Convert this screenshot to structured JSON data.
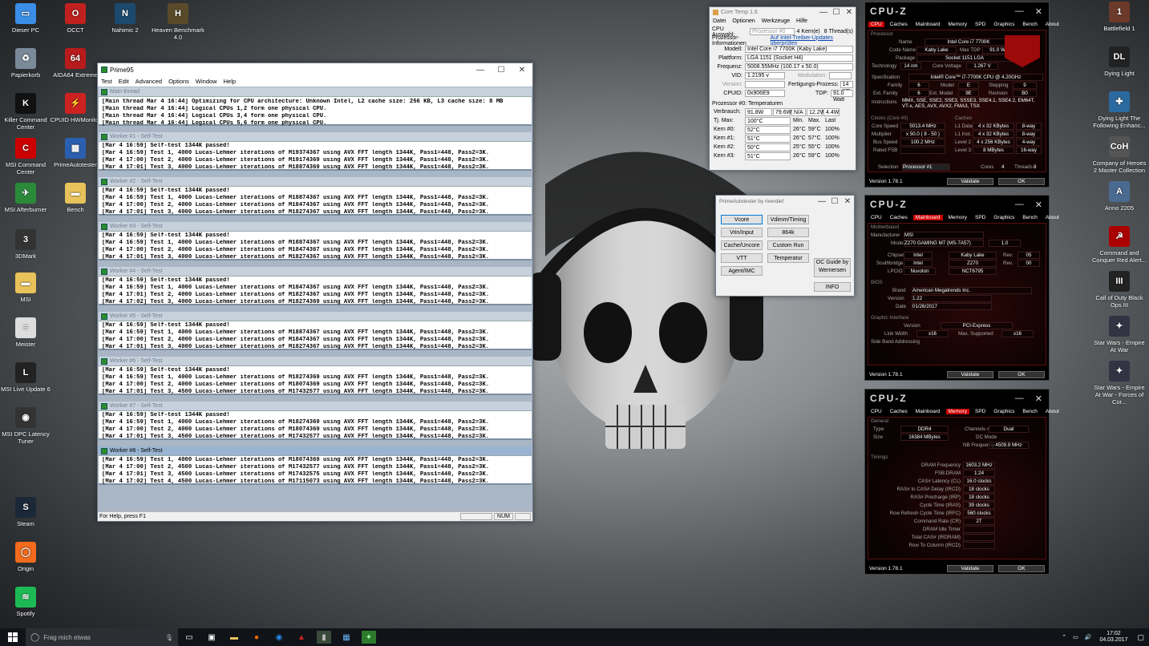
{
  "colors": {
    "accent": "#c00000",
    "p95_title": "#99b4d1",
    "taskbar": "#101418"
  },
  "desktop_left": [
    {
      "label": "Dieser PC",
      "icon": "computer-icon",
      "color": "#3a8ee6",
      "glyph": "▭"
    },
    {
      "label": "OCCT",
      "icon": "occt-icon",
      "color": "#c0211f",
      "glyph": "O"
    },
    {
      "label": "Nahimic 2",
      "icon": "nahimic-icon",
      "color": "#1c4a6e",
      "glyph": "N"
    },
    {
      "label": "Heaven Benchmark 4.0",
      "icon": "heaven-icon",
      "color": "#5a4a2a",
      "glyph": "H"
    },
    {
      "label": "Papierkorb",
      "icon": "recycle-bin-icon",
      "color": "#7a8a99",
      "glyph": "♻"
    },
    {
      "label": "AIDA64 Extreme",
      "icon": "aida64-icon",
      "color": "#b81b1b",
      "glyph": "64"
    },
    {
      "label": "Killer Command Center",
      "icon": "killer-icon",
      "color": "#111",
      "glyph": "K"
    },
    {
      "label": "CPUID HWMonitor",
      "icon": "hwmonitor-icon",
      "color": "#c22",
      "glyph": "⚡"
    },
    {
      "label": "MSI Command Center",
      "icon": "msi-cc-icon",
      "color": "#c00",
      "glyph": "C"
    },
    {
      "label": "PrimeAutotester",
      "icon": "primeautotester-icon",
      "color": "#2b5fb0",
      "glyph": "▦"
    },
    {
      "label": "MSI Afterburner",
      "icon": "afterburner-icon",
      "color": "#2a8a3a",
      "glyph": "✈"
    },
    {
      "label": "Bench",
      "icon": "folder-icon",
      "color": "#e8c25a",
      "glyph": "▬"
    },
    {
      "label": "3DMark",
      "icon": "3dmark-icon",
      "color": "#333",
      "glyph": "3"
    },
    {
      "label": "MSI",
      "icon": "folder-icon",
      "color": "#e8c25a",
      "glyph": "▬"
    },
    {
      "label": "Meister",
      "icon": "document-icon",
      "color": "#ddd",
      "glyph": "≡"
    },
    {
      "label": "MSI Live Update 6",
      "icon": "live-update-icon",
      "color": "#222",
      "glyph": "L"
    },
    {
      "label": "MSI DPC Latency Tuner",
      "icon": "dpc-icon",
      "color": "#333",
      "glyph": "◉"
    },
    {
      "label": "Steam",
      "icon": "steam-icon",
      "color": "#1b2838",
      "glyph": "S"
    },
    {
      "label": "Origin",
      "icon": "origin-icon",
      "color": "#f36c1e",
      "glyph": "◯"
    },
    {
      "label": "Spotify",
      "icon": "spotify-icon",
      "color": "#1db954",
      "glyph": "≋"
    }
  ],
  "desktop_right": [
    {
      "label": "Battlefield 1",
      "icon": "battlefield-icon",
      "color": "#6b3a2a",
      "glyph": "1"
    },
    {
      "label": "Dying Light",
      "icon": "dying-light-icon",
      "color": "#222",
      "glyph": "DL"
    },
    {
      "label": "Dying Light The Following Enhanc...",
      "icon": "dying-light-following-icon",
      "color": "#2a6aa0",
      "glyph": "✚"
    },
    {
      "label": "Company of Heroes 2 Master Collection",
      "icon": "coh2-icon",
      "color": "#555",
      "glyph": "CoH"
    },
    {
      "label": "Anno 2205",
      "icon": "anno-icon",
      "color": "#4a6a90",
      "glyph": "A"
    },
    {
      "label": "Command and Conquer Red Alert...",
      "icon": "red-alert-icon",
      "color": "#a00",
      "glyph": "☭"
    },
    {
      "label": "Call of Duty Black Ops III",
      "icon": "cod-icon",
      "color": "#222",
      "glyph": "III"
    },
    {
      "label": "Star Wars - Empire At War",
      "icon": "swe-icon",
      "color": "#334",
      "glyph": "✦"
    },
    {
      "label": "Star Wars - Empire At War - Forces of Cor...",
      "icon": "swe-foc-icon",
      "color": "#334",
      "glyph": "✦"
    }
  ],
  "prime95": {
    "title": "Prime95",
    "menu": [
      "Test",
      "Edit",
      "Advanced",
      "Options",
      "Window",
      "Help"
    ],
    "main_title": "Main thread",
    "main_lines": [
      "[Main thread Mar 4 16:44] Optimizing for CPU architecture: Unknown Intel, L2 cache size: 256 KB, L3 cache size: 8 MB",
      "[Main thread Mar 4 16:44] Logical CPUs 1,2 form one physical CPU.",
      "[Main thread Mar 4 16:44] Logical CPUs 3,4 form one physical CPU.",
      "[Main thread Mar 4 16:44] Logical CPUs 5,6 form one physical CPU."
    ],
    "workers": [
      {
        "title": "Worker #1 - Self-Test",
        "lines": [
          "[Mar 4 16:59] Self-test 1344K passed!",
          "[Mar 4 16:59] Test 1, 4000 Lucas-Lehmer iterations of M19374367 using AVX FFT length 1344K, Pass1=448, Pass2=3K.",
          "[Mar 4 17:00] Test 2, 4000 Lucas-Lehmer iterations of M19174369 using AVX FFT length 1344K, Pass1=448, Pass2=3K.",
          "[Mar 4 17:01] Test 3, 4000 Lucas-Lehmer iterations of M18874369 using AVX FFT length 1344K, Pass1=448, Pass2=3K."
        ]
      },
      {
        "title": "Worker #2 - Self-Test",
        "lines": [
          "[Mar 4 16:59] Self-test 1344K passed!",
          "[Mar 4 16:59] Test 1, 4000 Lucas-Lehmer iterations of M18874367 using AVX FFT length 1344K, Pass1=448, Pass2=3K.",
          "[Mar 4 17:00] Test 2, 4000 Lucas-Lehmer iterations of M18474367 using AVX FFT length 1344K, Pass1=448, Pass2=3K.",
          "[Mar 4 17:01] Test 3, 4000 Lucas-Lehmer iterations of M18274367 using AVX FFT length 1344K, Pass1=448, Pass2=3K."
        ]
      },
      {
        "title": "Worker #3 - Self-Test",
        "lines": [
          "[Mar 4 16:59] Self-test 1344K passed!",
          "[Mar 4 16:59] Test 1, 4000 Lucas-Lehmer iterations of M18874367 using AVX FFT length 1344K, Pass1=448, Pass2=3K.",
          "[Mar 4 17:00] Test 2, 4000 Lucas-Lehmer iterations of M18474367 using AVX FFT length 1344K, Pass1=448, Pass2=3K.",
          "[Mar 4 17:01] Test 3, 4000 Lucas-Lehmer iterations of M18274367 using AVX FFT length 1344K, Pass1=448, Pass2=3K."
        ]
      },
      {
        "title": "Worker #4 - Self-Test",
        "lines": [
          "[Mar 4 16:59] Self-test 1344K passed!",
          "[Mar 4 16:59] Test 1, 4000 Lucas-Lehmer iterations of M18474367 using AVX FFT length 1344K, Pass1=448, Pass2=3K.",
          "[Mar 4 17:01] Test 2, 4000 Lucas-Lehmer iterations of M18274367 using AVX FFT length 1344K, Pass1=448, Pass2=3K.",
          "[Mar 4 17:02] Test 3, 4000 Lucas-Lehmer iterations of M18274369 using AVX FFT length 1344K, Pass1=448, Pass2=3K."
        ]
      },
      {
        "title": "Worker #5 - Self-Test",
        "lines": [
          "[Mar 4 16:59] Self-test 1344K passed!",
          "[Mar 4 16:59] Test 1, 4000 Lucas-Lehmer iterations of M18874367 using AVX FFT length 1344K, Pass1=448, Pass2=3K.",
          "[Mar 4 17:00] Test 2, 4000 Lucas-Lehmer iterations of M18474367 using AVX FFT length 1344K, Pass1=448, Pass2=3K.",
          "[Mar 4 17:01] Test 3, 4000 Lucas-Lehmer iterations of M18274367 using AVX FFT length 1344K, Pass1=448, Pass2=3K."
        ]
      },
      {
        "title": "Worker #6 - Self-Test",
        "lines": [
          "[Mar 4 16:59] Self-test 1344K passed!",
          "[Mar 4 16:59] Test 1, 4000 Lucas-Lehmer iterations of M18274369 using AVX FFT length 1344K, Pass1=448, Pass2=3K.",
          "[Mar 4 17:00] Test 2, 4000 Lucas-Lehmer iterations of M18074369 using AVX FFT length 1344K, Pass1=448, Pass2=3K.",
          "[Mar 4 17:01] Test 3, 4500 Lucas-Lehmer iterations of M17432577 using AVX FFT length 1344K, Pass1=448, Pass2=3K."
        ]
      },
      {
        "title": "Worker #7 - Self-Test",
        "lines": [
          "[Mar 4 16:59] Self-test 1344K passed!",
          "[Mar 4 16:59] Test 1, 4000 Lucas-Lehmer iterations of M18274369 using AVX FFT length 1344K, Pass1=448, Pass2=3K.",
          "[Mar 4 17:00] Test 2, 4000 Lucas-Lehmer iterations of M18074369 using AVX FFT length 1344K, Pass1=448, Pass2=3K.",
          "[Mar 4 17:01] Test 3, 4500 Lucas-Lehmer iterations of M17432577 using AVX FFT length 1344K, Pass1=448, Pass2=3K."
        ]
      },
      {
        "title": "Worker #8 - Self-Test",
        "lines": [
          "[Mar 4 16:59] Test 1, 4000 Lucas-Lehmer iterations of M18074369 using AVX FFT length 1344K, Pass1=448, Pass2=3K.",
          "[Mar 4 17:00] Test 2, 4500 Lucas-Lehmer iterations of M17432577 using AVX FFT length 1344K, Pass1=448, Pass2=3K.",
          "[Mar 4 17:01] Test 3, 4500 Lucas-Lehmer iterations of M17432575 using AVX FFT length 1344K, Pass1=448, Pass2=3K.",
          "[Mar 4 17:02] Test 4, 4500 Lucas-Lehmer iterations of M17115073 using AVX FFT length 1344K, Pass1=448, Pass2=3K."
        ]
      }
    ],
    "status": "For Help, press F1",
    "num": "NUM"
  },
  "coretemp": {
    "title": "Core Temp 1.6",
    "menu": [
      "Datei",
      "Optionen",
      "Werkzeuge",
      "Hilfe"
    ],
    "cpu_sel_label": "CPU Auswahl:",
    "cpu_sel": "Prozessor #0",
    "cores": "4",
    "cores_label": "Kern(e)",
    "threads": "8",
    "threads_label": "Thread(s)",
    "info_label": "Prozessor-Informationen",
    "info_link": "Auf Intel-Treiber-Updates überprüfen",
    "model_label": "Modell:",
    "model": "Intel Core i7 7700K (Kaby Lake)",
    "platform_label": "Plattform:",
    "platform": "LGA 1151 (Socket H4)",
    "freq_label": "Frequenz:",
    "freq": "5008.55MHz (100.17 x 50.0)",
    "vid_label": "VID:",
    "vid": "1.2195 v",
    "mod_label": "Modulation:",
    "version_label": "Version:",
    "lith_label": "Fertigungs-Prozess:",
    "lith": "14 nm",
    "cpuid_label": "CPUID:",
    "cpuid": "0x906E9",
    "tdp_label": "TDP:",
    "tdp": "91.0 Watt",
    "temps_label": "Prozessor #0: Temperaturen",
    "power_label": "Verbrauch:",
    "power": [
      "91.8W",
      "79.6W",
      "N/A",
      "12.2W",
      "4.4W"
    ],
    "tjmax_label": "Tj. Max:",
    "tjmax": "100°C",
    "cols": [
      "Min.",
      "Max.",
      "Last"
    ],
    "cores_rows": [
      {
        "name": "Kern #0:",
        "temp": "52°C",
        "min": "26°C",
        "max": "59°C",
        "load": "100%"
      },
      {
        "name": "Kern #1:",
        "temp": "51°C",
        "min": "26°C",
        "max": "57°C",
        "load": "100%"
      },
      {
        "name": "Kern #2:",
        "temp": "50°C",
        "min": "25°C",
        "max": "55°C",
        "load": "100%"
      },
      {
        "name": "Kern #3:",
        "temp": "51°C",
        "min": "26°C",
        "max": "59°C",
        "load": "100%"
      }
    ]
  },
  "autotester": {
    "title": "PrimeAutotester by riverdief",
    "buttons": [
      "Vcore",
      "Vdimm/Timing",
      "Vrin/Input",
      "864k",
      "Cache/Uncore",
      "Custom Run",
      "VTT",
      "Temperatur",
      "Agent/IMC"
    ],
    "oc_guide": "OC Guide by Wernersen",
    "info": "INFO"
  },
  "cpuz1": {
    "brand": "CPU-Z",
    "tabs": [
      "CPU",
      "Caches",
      "Mainboard",
      "Memory",
      "SPD",
      "Graphics",
      "Bench",
      "About"
    ],
    "section": "Processor",
    "name_l": "Name",
    "name": "Intel Core i7 7700K",
    "code_l": "Code Name",
    "code": "Kaby Lake",
    "tdp_l": "Max TDP",
    "tdp": "91.0 W",
    "pkg_l": "Package",
    "pkg": "Socket 1151 LGA",
    "tech_l": "Technology",
    "tech": "14 nm",
    "cv_l": "Core Voltage",
    "cv": "1.267 V",
    "spec_l": "Specification",
    "spec": "Intel® Core™ i7-7700K CPU @ 4.20GHz",
    "fam_l": "Family",
    "fam": "6",
    "mod_l": "Model",
    "mod": "E",
    "step_l": "Stepping",
    "step": "9",
    "efam_l": "Ext. Family",
    "efam": "6",
    "emod_l": "Ext. Model",
    "emod": "9E",
    "rev_l": "Revision",
    "rev": "B0",
    "inst_l": "Instructions",
    "inst": "MMX, SSE, SSE2, SSE3, SSSE3, SSE4.1, SSE4.2, EM64T, VT-x, AES, AVX, AVX2, FMA3, TSX",
    "clocks": "Clocks (Core #0)",
    "caches": "Caches",
    "cs_l": "Core Speed",
    "cs": "5013.4 MHz",
    "l1d_l": "L1 Data",
    "l1d": "4 x 32 KBytes",
    "l1d_w": "8-way",
    "mul_l": "Multiplier",
    "mul": "x 50.0 ( 8 - 50 )",
    "l1i_l": "L1 Inst.",
    "l1i": "4 x 32 KBytes",
    "l1i_w": "8-way",
    "bs_l": "Bus Speed",
    "bs": "100.2 MHz",
    "l2_l": "Level 2",
    "l2": "4 x 256 KBytes",
    "l2_w": "4-way",
    "fsb_l": "Rated FSB",
    "l3_l": "Level 3",
    "l3": "8 MBytes",
    "l3_w": "16-way",
    "sel_l": "Selection",
    "sel": "Processor #1",
    "cores_l": "Cores",
    "cores": "4",
    "thr_l": "Threads",
    "thr": "8",
    "ver": "Version 1.78.1",
    "validate": "Validate",
    "ok": "OK"
  },
  "cpuz2": {
    "brand": "CPU-Z",
    "tabs": [
      "CPU",
      "Caches",
      "Mainboard",
      "Memory",
      "SPD",
      "Graphics",
      "Bench",
      "About"
    ],
    "section": "Motherboard",
    "man_l": "Manufacturer",
    "man": "MSI",
    "model_l": "Model",
    "model": "Z270 GAMING M7 (MS-7A57)",
    "model_rev": "1.0",
    "chip_l": "Chipset",
    "chip": "Intel",
    "chip2": "Kaby Lake",
    "chip_rev_l": "Rev.",
    "chip_rev": "05",
    "sb_l": "Southbridge",
    "sb": "Intel",
    "sb2": "Z270",
    "sb_rev_l": "Rev.",
    "sb_rev": "00",
    "lpc_l": "LPCIO",
    "lpc": "Nuvoton",
    "lpc2": "NCT6795",
    "bios": "BIOS",
    "brand_l": "Brand",
    "bbrand": "American Megatrends Inc.",
    "bver_l": "Version",
    "bver": "1.22",
    "bdate_l": "Date",
    "bdate": "01/26/2017",
    "gi": "Graphic Interface",
    "gver_l": "Version",
    "gver": "PCI-Express",
    "lw_l": "Link Width",
    "lw": "x16",
    "ms_l": "Max. Supported",
    "ms": "x16",
    "sba_l": "Side Band Addressing",
    "ver": "Version 1.78.1",
    "validate": "Validate",
    "ok": "OK"
  },
  "cpuz3": {
    "brand": "CPU-Z",
    "tabs": [
      "CPU",
      "Caches",
      "Mainboard",
      "Memory",
      "SPD",
      "Graphics",
      "Bench",
      "About"
    ],
    "section": "General",
    "type_l": "Type",
    "type": "DDR4",
    "ch_l": "Channels #",
    "ch": "Dual",
    "size_l": "Size",
    "size": "16384 MBytes",
    "dc_l": "DC Mode",
    "nb_l": "NB Frequency",
    "nb": "4509.9 MHz",
    "timings": "Timings",
    "t_labels": [
      "DRAM Frequency",
      "FSB:DRAM",
      "CAS# Latency (CL)",
      "RAS# to CAS# Delay (tRCD)",
      "RAS# Precharge (tRP)",
      "Cycle Time (tRAS)",
      "Row Refresh Cycle Time (tRFC)",
      "Command Rate (CR)",
      "DRAM Idle Timer",
      "Total CAS# (tRDRAM)",
      "Row To Column (tRCD)"
    ],
    "t_values": [
      "1603.2 MHz",
      "1:24",
      "16.0 clocks",
      "18 clocks",
      "18 clocks",
      "39 clocks",
      "560 clocks",
      "2T",
      "",
      "",
      ""
    ],
    "ver": "Version 1.78.1",
    "validate": "Validate",
    "ok": "OK"
  },
  "taskbar": {
    "search": "Frag mich etwas",
    "time": "17:02",
    "date": "04.03.2017"
  }
}
